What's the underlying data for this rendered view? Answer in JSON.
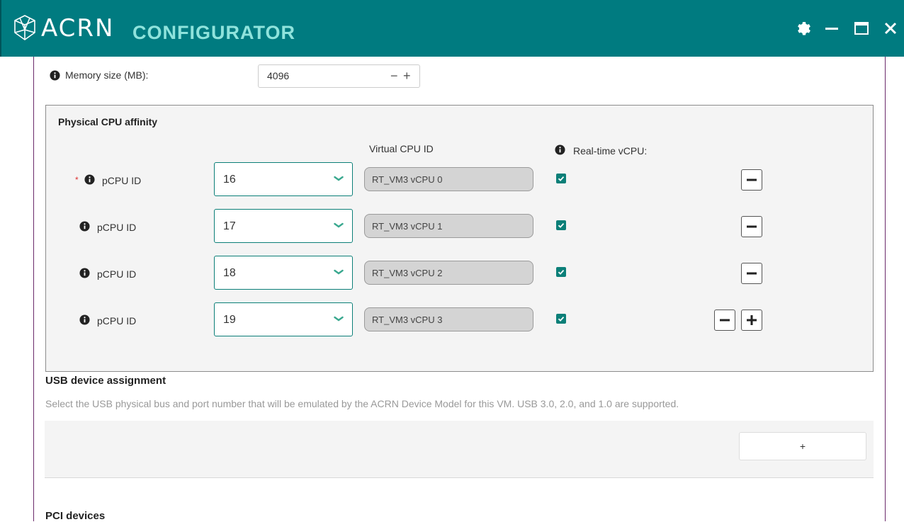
{
  "app": {
    "brand": "ACRN",
    "product": "CONFIGURATOR",
    "logo_icon": "acrn-logo-icon",
    "window_controls": [
      "gear-icon",
      "minimize-icon",
      "maximize-icon",
      "close-icon"
    ]
  },
  "memory": {
    "label": "Memory size (MB):",
    "value": "4096",
    "minus": "−",
    "plus": "+"
  },
  "cpu_affinity": {
    "title": "Physical CPU affinity",
    "vcpu_header": "Virtual CPU ID",
    "rt_header": "Real-time vCPU:",
    "required_marker": "*",
    "rows": [
      {
        "label": "pCPU ID",
        "pcpu": "16",
        "vcpu": "RT_VM3 vCPU 0",
        "realtime": true
      },
      {
        "label": "pCPU ID",
        "pcpu": "17",
        "vcpu": "RT_VM3 vCPU 1",
        "realtime": true
      },
      {
        "label": "pCPU ID",
        "pcpu": "18",
        "vcpu": "RT_VM3 vCPU 2",
        "realtime": true
      },
      {
        "label": "pCPU ID",
        "pcpu": "19",
        "vcpu": "RT_VM3 vCPU 3",
        "realtime": true
      }
    ]
  },
  "usb": {
    "title": "USB device assignment",
    "description": "Select the USB physical bus and port number that will be emulated by the ACRN Device Model for this VM. USB 3.0, 2.0, and 1.0 are supported.",
    "add_label": "+"
  },
  "pci": {
    "title": "PCI devices"
  },
  "colors": {
    "titlebar": "#007b80",
    "product": "#8fe3dc",
    "accent": "#0b7f78"
  }
}
